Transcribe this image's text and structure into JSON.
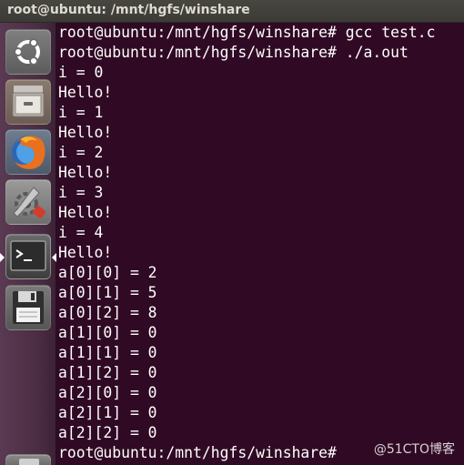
{
  "window": {
    "title": "root@ubuntu: /mnt/hgfs/winshare"
  },
  "launcher": {
    "items": [
      {
        "name": "dash-home",
        "icon": "ubuntu-logo-icon"
      },
      {
        "name": "files",
        "icon": "file-cabinet-icon"
      },
      {
        "name": "firefox",
        "icon": "firefox-icon"
      },
      {
        "name": "system-settings",
        "icon": "wrench-gear-icon"
      },
      {
        "name": "terminal",
        "icon": "terminal-icon"
      },
      {
        "name": "save",
        "icon": "floppy-disk-icon"
      }
    ],
    "active_item": "terminal"
  },
  "terminal": {
    "lines": [
      "root@ubuntu:/mnt/hgfs/winshare# gcc test.c",
      "root@ubuntu:/mnt/hgfs/winshare# ./a.out",
      "i = 0",
      "Hello!",
      "i = 1",
      "Hello!",
      "i = 2",
      "Hello!",
      "i = 3",
      "Hello!",
      "i = 4",
      "Hello!",
      "a[0][0] = 2",
      "a[0][1] = 5",
      "a[0][2] = 8",
      "a[1][0] = 0",
      "a[1][1] = 0",
      "a[1][2] = 0",
      "a[2][0] = 0",
      "a[2][1] = 0",
      "a[2][2] = 0",
      "root@ubuntu:/mnt/hgfs/winshare#"
    ]
  },
  "watermark": "@51CTO博客",
  "colors": {
    "terminal_bg": "#300a24",
    "terminal_fg": "#ffffff",
    "titlebar_bg": "#3c3b37"
  }
}
